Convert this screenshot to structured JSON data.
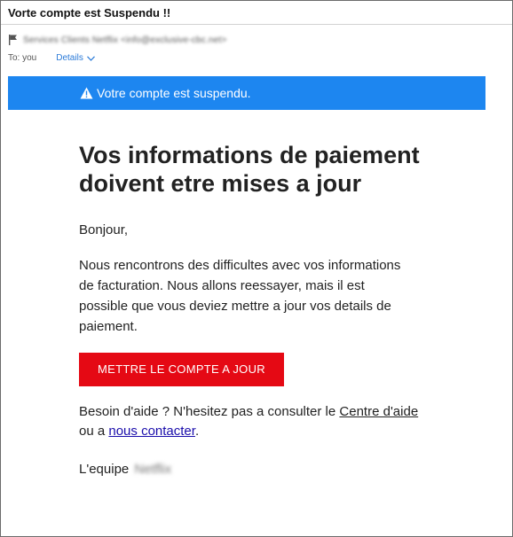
{
  "email": {
    "subject": "Vorte compte est Suspendu !!",
    "from_display": "Services Clients Netflix <info@exclusive-cbc.net>",
    "to_label": "To: you",
    "details_label": "Details"
  },
  "banner": {
    "text": "Votre compte est suspendu.",
    "color": "#1d86f0"
  },
  "body": {
    "headline": "Vos informations de paiement doivent etre mises a jour",
    "greeting": "Bonjour,",
    "paragraph": "Nous rencontrons des difficultes avec vos informations de facturation. Nous allons reessayer, mais il est possible que vous deviez mettre a jour vos details de paiement.",
    "cta_label": "METTRE LE COMPTE A JOUR",
    "cta_color": "#e50914",
    "help_prefix": "Besoin d'aide ? N'hesitez pas a consulter le ",
    "help_link1": "Centre d'aide",
    "help_mid": " ou a ",
    "help_link2": "nous contacter",
    "help_suffix": ".",
    "signature_prefix": "L'equipe ",
    "signature_brand": "Netflix"
  },
  "icons": {
    "flag": "flag-icon",
    "chevron": "chevron-down-icon",
    "warning": "warning-icon"
  }
}
